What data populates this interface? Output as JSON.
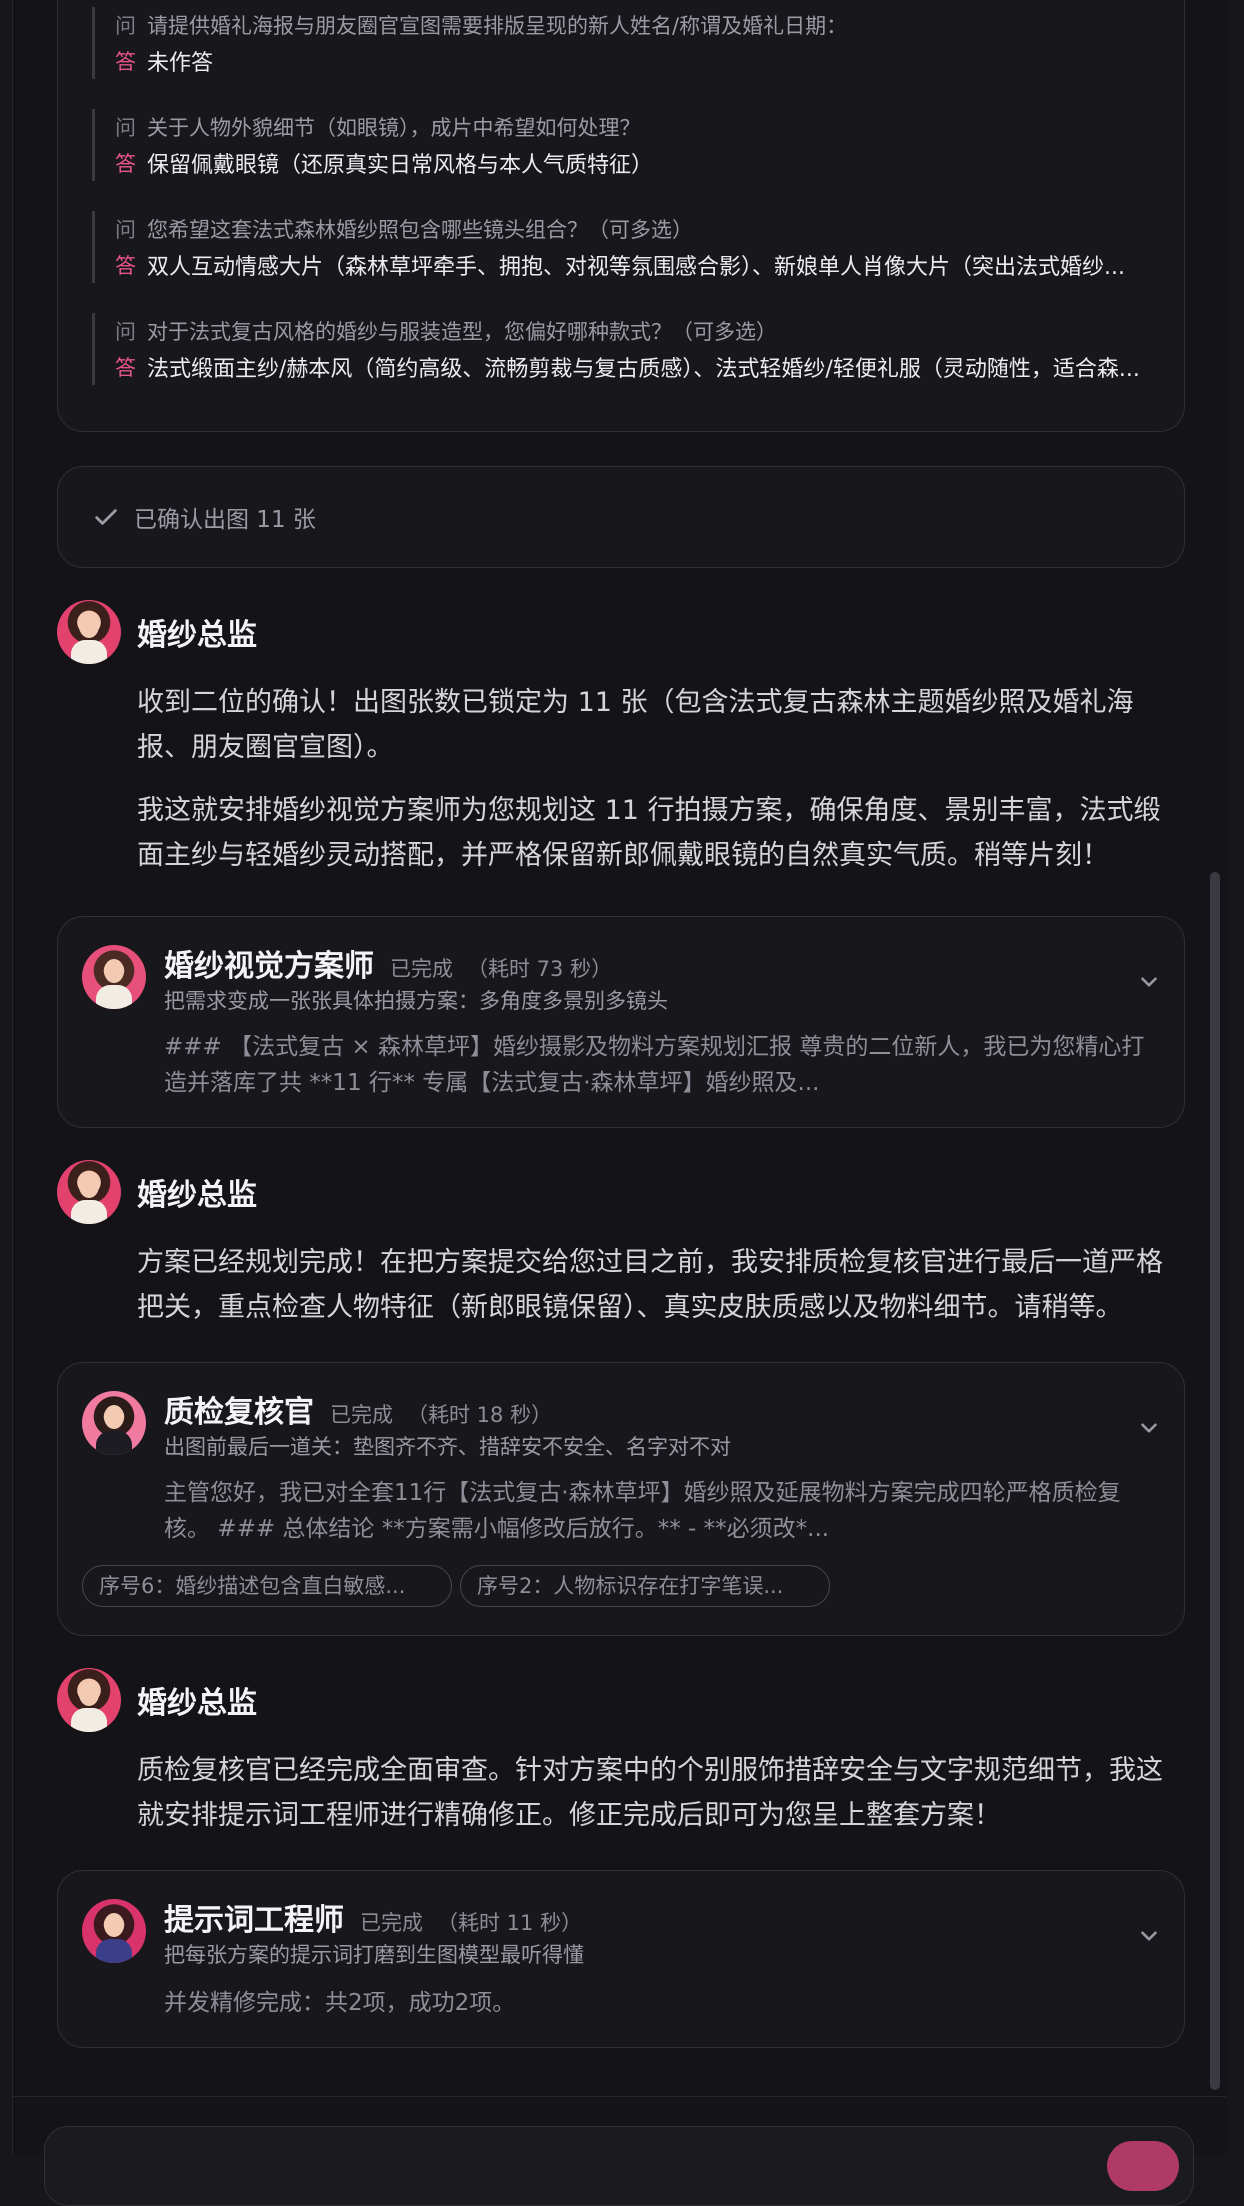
{
  "qa": {
    "q_mark": "问",
    "a_mark": "答",
    "items": [
      {
        "q": "请提供婚礼海报与朋友圈官宣图需要排版呈现的新人姓名/称谓及婚礼日期：",
        "a": "未作答"
      },
      {
        "q": "关于人物外貌细节（如眼镜），成片中希望如何处理？",
        "a": "保留佩戴眼镜（还原真实日常风格与本人气质特征）"
      },
      {
        "q": "您希望这套法式森林婚纱照包含哪些镜头组合？（可多选）",
        "a": "双人互动情感大片（森林草坪牵手、拥抱、对视等氛围感合影）、新娘单人肖像大片（突出法式婚纱..."
      },
      {
        "q": "对于法式复古风格的婚纱与服装造型，您偏好哪种款式？（可多选）",
        "a": "法式缎面主纱/赫本风（简约高级、流畅剪裁与复古质感）、法式轻婚纱/轻便礼服（灵动随性，适合森..."
      }
    ]
  },
  "confirm": {
    "text": "已确认出图 11 张",
    "icon": "check-icon"
  },
  "messages": [
    {
      "name": "婚纱总监",
      "paragraphs": [
        "收到二位的确认！出图张数已锁定为 11 张（包含法式复古森林主题婚纱照及婚礼海报、朋友圈官宣图）。",
        "我这就安排婚纱视觉方案师为您规划这 11 行拍摄方案，确保角度、景别丰富，法式缎面主纱与轻婚纱灵动搭配，并严格保留新郎佩戴眼镜的自然真实气质。稍等片刻！"
      ]
    },
    {
      "name": "婚纱总监",
      "paragraphs": [
        "方案已经规划完成！在把方案提交给您过目之前，我安排质检复核官进行最后一道严格把关，重点检查人物特征（新郎眼镜保留）、真实皮肤质感以及物料细节。请稍等。"
      ]
    },
    {
      "name": "婚纱总监",
      "paragraphs": [
        "质检复核官已经完成全面审查。针对方案中的个别服饰措辞安全与文字规范细节，我这就安排提示词工程师进行精确修正。修正完成后即可为您呈上整套方案！"
      ]
    }
  ],
  "agents": [
    {
      "name": "婚纱视觉方案师",
      "status": "已完成",
      "time": "（耗时 73 秒）",
      "subtitle": "把需求变成一张张具体拍摄方案：多角度多景别多镜头",
      "body": "### 【法式复古 × 森林草坪】婚纱摄影及物料方案规划汇报 尊贵的二位新人，我已为您精心打造并落库了共 **11 行** 专属【法式复古·森林草坪】婚纱照及..."
    },
    {
      "name": "质检复核官",
      "status": "已完成",
      "time": "（耗时 18 秒）",
      "subtitle": "出图前最后一道关：垫图齐不齐、措辞安不安全、名字对不对",
      "body": "主管您好，我已对全套11行【法式复古·森林草坪】婚纱照及延展物料方案完成四轮严格质检复核。 ### 总体结论 **方案需小幅修改后放行。** - **必须改*...",
      "chips": [
        "序号6：婚纱描述包含直白敏感...",
        "序号2：人物标识存在打字笔误..."
      ]
    },
    {
      "name": "提示词工程师",
      "status": "已完成",
      "time": "（耗时 11 秒）",
      "subtitle": "把每张方案的提示词打磨到生图模型最听得懂",
      "body": "并发精修完成：共2项，成功2项。"
    }
  ],
  "colors": {
    "accent": "#e8558a",
    "background": "#141418",
    "card_border": "#2f2f36"
  }
}
